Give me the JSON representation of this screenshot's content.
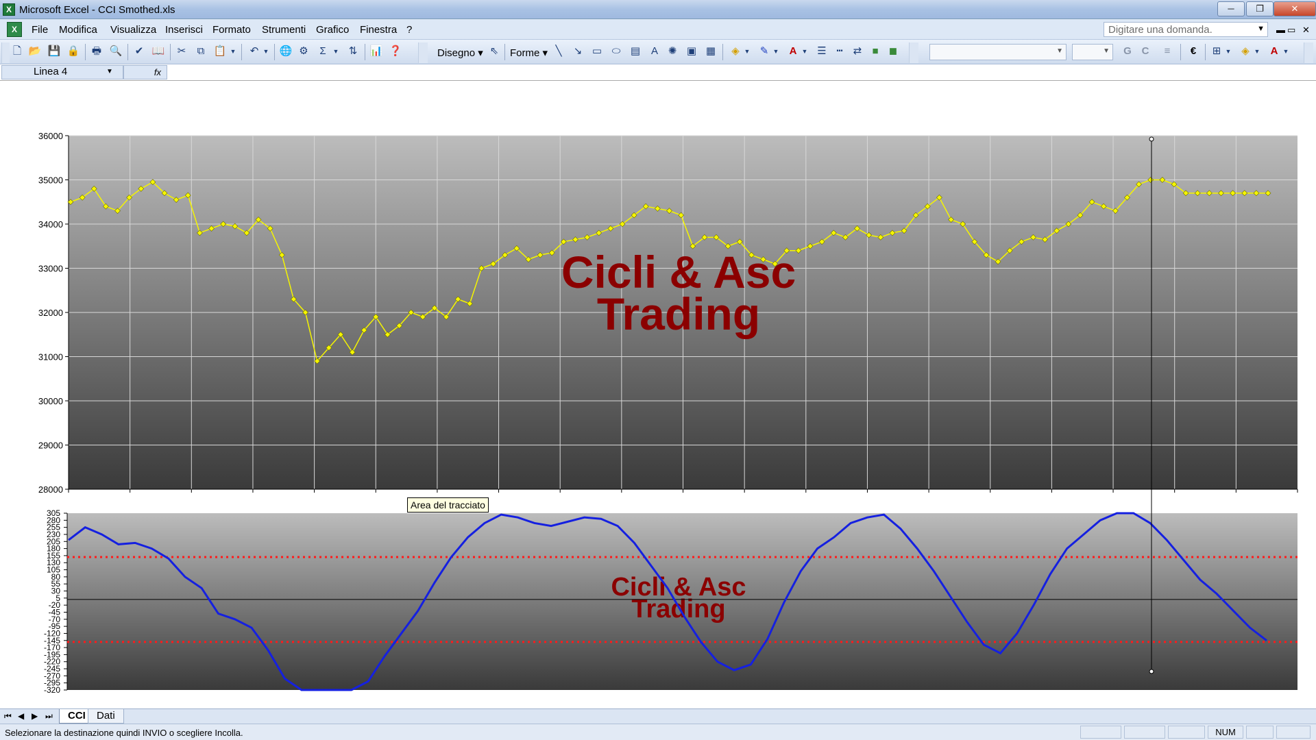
{
  "window": {
    "title": "Microsoft Excel - CCI Smothed.xls",
    "app_icon": "excel-icon",
    "controls": {
      "minimize": "─",
      "maximize": "❐",
      "close": "✕"
    }
  },
  "menu": {
    "items": [
      "File",
      "Modifica",
      "Visualizza",
      "Inserisci",
      "Formato",
      "Strumenti",
      "Grafico",
      "Finestra",
      "?"
    ],
    "help_placeholder": "Digitare una domanda.",
    "doc_controls": [
      "▬",
      "▭",
      "✕"
    ]
  },
  "toolbar": {
    "draw_label": "Disegno",
    "shapes_label": "Forme",
    "bold_label": "G",
    "italic_label": "C",
    "euro_symbol": "€"
  },
  "formula_bar": {
    "name_box": "Linea 4",
    "fx_label": "fx"
  },
  "tooltip": "Area del tracciato",
  "watermark": {
    "line1": "Cicli & Asc",
    "line2": "Trading"
  },
  "sheets": {
    "tabs": [
      "CCI",
      "Dati"
    ],
    "active": "CCI"
  },
  "status": {
    "message": "Selezionare la destinazione quindi INVIO o scegliere Incolla.",
    "num_indicator": "NUM"
  },
  "colors": {
    "price_series": "#f5f500",
    "cci_series": "#1520e0",
    "threshold_lines": "#ff1a1a",
    "watermark": "#8b0000"
  },
  "chart_data": [
    {
      "type": "line",
      "title": "",
      "ylim": [
        28000,
        36000
      ],
      "yticks": [
        "36000",
        "35000",
        "34000",
        "33000",
        "32000",
        "31000",
        "30000",
        "29000",
        "28000"
      ],
      "series": [
        {
          "values": [
            34500,
            34600,
            34800,
            34400,
            34300,
            34600,
            34800,
            34950,
            34700,
            34550,
            34650,
            33800,
            33900,
            34000,
            33950,
            33800,
            34100,
            33900,
            33300,
            32300,
            32000,
            30900,
            31200,
            31500,
            31100,
            31600,
            31900,
            31500,
            31700,
            32000,
            31900,
            32100,
            31900,
            32300,
            32200,
            33000,
            33100,
            33300,
            33450,
            33200,
            33300,
            33350,
            33600,
            33650,
            33700,
            33800,
            33900,
            34000,
            34200,
            34400,
            34350,
            34300,
            34200,
            33500,
            33700,
            33700,
            33500,
            33600,
            33300,
            33200,
            33100,
            33400,
            33400,
            33500,
            33600,
            33800,
            33700,
            33900,
            33750,
            33700,
            33800,
            33850,
            34200,
            34400,
            34600,
            34100,
            34000,
            33600,
            33300,
            33150,
            33400,
            33600,
            33700,
            33650,
            33850,
            34000,
            34200,
            34500,
            34400,
            34300,
            34600,
            34900,
            35000,
            35000,
            34900,
            34700,
            34700,
            34700,
            34700,
            34700,
            34700,
            34700,
            34700
          ]
        }
      ]
    },
    {
      "type": "line",
      "title": "",
      "ylim": [
        -320,
        305
      ],
      "yticks": [
        "305",
        "280",
        "255",
        "230",
        "205",
        "180",
        "155",
        "130",
        "105",
        "80",
        "55",
        "30",
        "5",
        "-20",
        "-45",
        "-70",
        "-95",
        "-120",
        "-145",
        "-170",
        "-195",
        "-220",
        "-245",
        "-270",
        "-295",
        "-320"
      ],
      "threshold_lines": [
        150,
        -150
      ],
      "zero_line": 0,
      "series": [
        {
          "values": [
            210,
            255,
            230,
            195,
            200,
            180,
            145,
            80,
            40,
            -50,
            -70,
            -100,
            -180,
            -280,
            -320,
            -330,
            -330,
            -325,
            -290,
            -200,
            -120,
            -40,
            60,
            150,
            220,
            270,
            300,
            290,
            270,
            260,
            275,
            290,
            285,
            260,
            200,
            120,
            40,
            -60,
            -150,
            -220,
            -250,
            -230,
            -140,
            -10,
            100,
            180,
            220,
            270,
            290,
            300,
            250,
            180,
            100,
            10,
            -80,
            -160,
            -190,
            -120,
            -20,
            90,
            180,
            230,
            280,
            320,
            310,
            270,
            210,
            140,
            70,
            20,
            -40,
            -100,
            -145
          ]
        }
      ]
    }
  ]
}
